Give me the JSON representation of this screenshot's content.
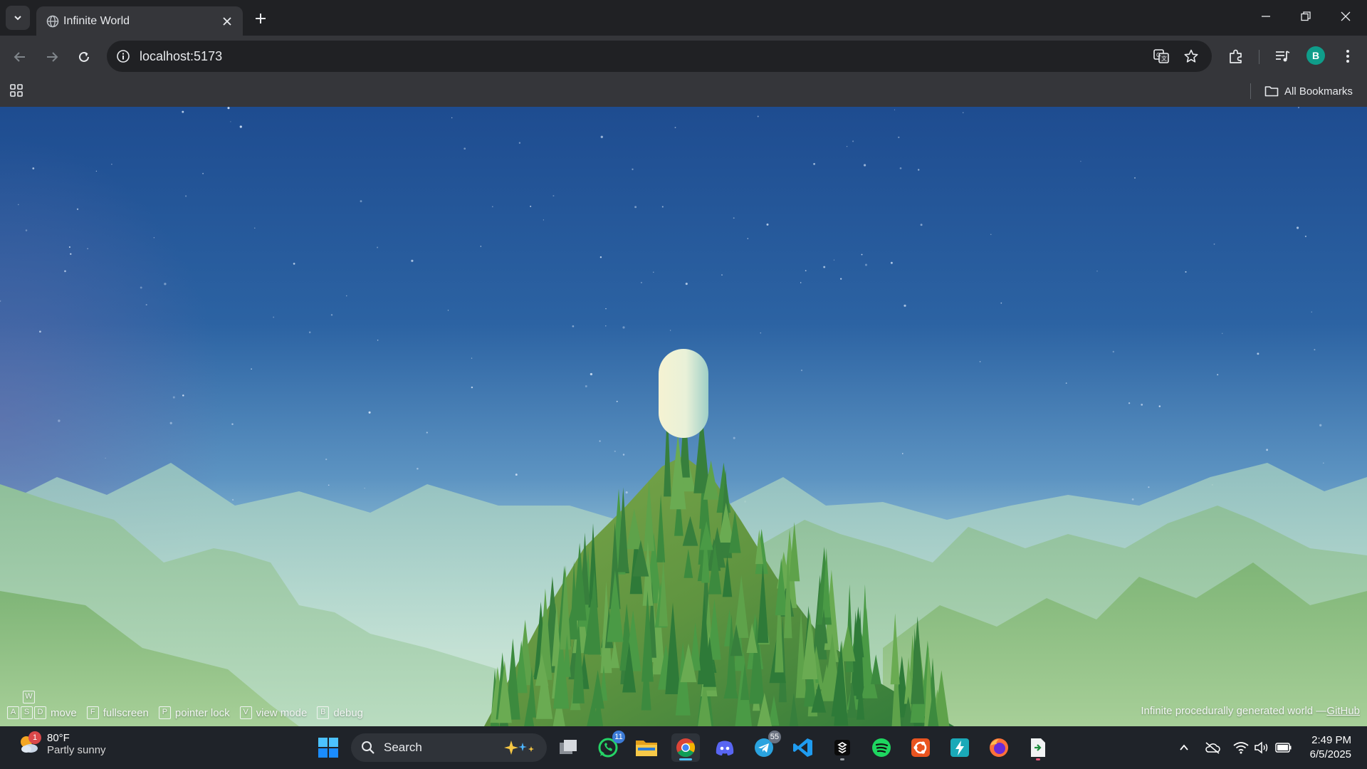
{
  "browser": {
    "tab_title": "Infinite World",
    "url": "localhost:5173",
    "profile_initial": "B",
    "bookmarks_label": "All Bookmarks"
  },
  "hud": {
    "keys": {
      "w": "W",
      "a": "A",
      "s": "S",
      "d": "D",
      "f": "F",
      "p": "P",
      "v": "V",
      "b": "B"
    },
    "move_label": "move",
    "fullscreen_label": "fullscreen",
    "pointer_lock_label": "pointer lock",
    "view_mode_label": "view mode",
    "debug_label": "debug",
    "credit_text": "Infinite procedurally generated world —",
    "credit_link": "GitHub"
  },
  "taskbar": {
    "weather_temp": "80°F",
    "weather_condition": "Partly sunny",
    "weather_badge": "1",
    "search_label": "Search",
    "whatsapp_badge": "11",
    "telegram_badge": "55",
    "time": "2:49 PM",
    "date": "6/5/2025"
  },
  "colors": {
    "sky_top": "#1f4f94",
    "sky_mid": "#3f7fb8",
    "horizon": "#cfe9e6",
    "grass_light": "#8fbf5a",
    "grass_dark": "#2f7a3a",
    "player_capsule": "#eef3d6"
  },
  "icons": [
    "tab-search-icon",
    "globe-icon",
    "close-icon",
    "plus-icon",
    "minimize-icon",
    "restore-icon",
    "window-close-icon",
    "back-icon",
    "forward-icon",
    "reload-icon",
    "info-icon",
    "translate-icon",
    "star-icon",
    "extensions-icon",
    "media-icon",
    "kebab-menu-icon",
    "apps-grid-icon",
    "folder-icon",
    "windows-start-icon",
    "search-icon",
    "task-view-icon",
    "whatsapp-icon",
    "file-explorer-icon",
    "chrome-icon",
    "discord-icon",
    "telegram-icon",
    "vscode-icon",
    "app-icon",
    "spotify-icon",
    "ubuntu-icon",
    "bolt-app-icon",
    "firefox-icon",
    "file-app-icon",
    "chevron-up-icon",
    "cloud-off-icon",
    "wifi-icon",
    "volume-icon",
    "battery-icon"
  ]
}
